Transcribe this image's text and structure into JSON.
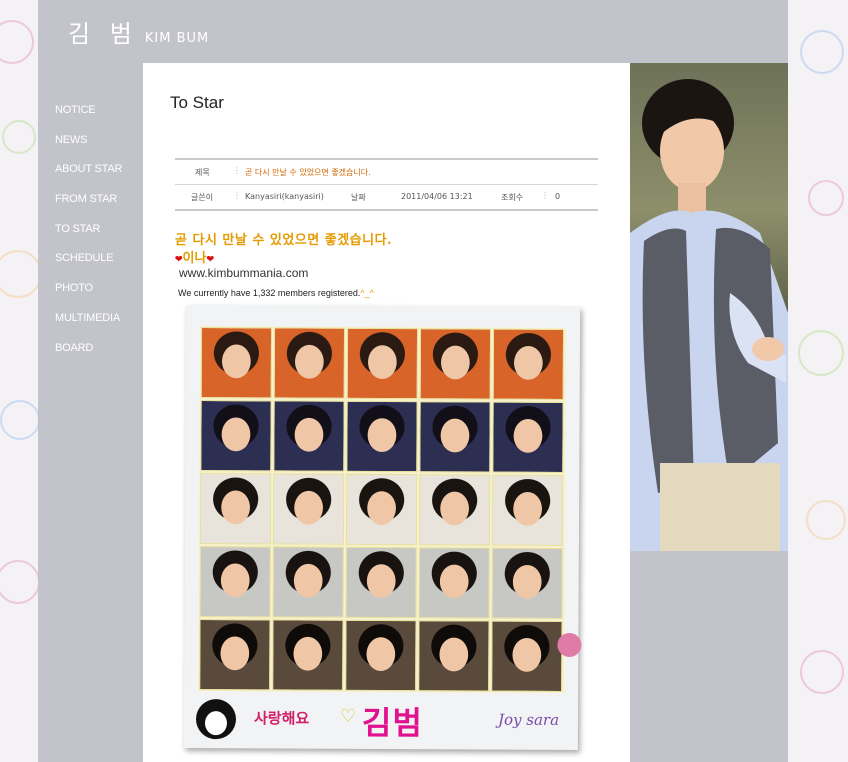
{
  "site": {
    "logo_korean": "김 범",
    "logo_english": "KIM BUM"
  },
  "nav": {
    "items": [
      {
        "label": "NOTICE"
      },
      {
        "label": "NEWS"
      },
      {
        "label": "ABOUT STAR"
      },
      {
        "label": "FROM STAR"
      },
      {
        "label": "TO STAR",
        "active": true
      },
      {
        "label": "SCHEDULE"
      },
      {
        "label": "PHOTO"
      },
      {
        "label": "MULTIMEDIA"
      },
      {
        "label": "BOARD"
      }
    ]
  },
  "page": {
    "title": "To Star"
  },
  "meta": {
    "subject_label": "제목",
    "subject_value": "곧 다시 만날 수 있었으면 좋겠습니다.",
    "author_label": "글쓴이",
    "author_value": "Kanyasiri(kanyasiri)",
    "date_label": "날짜",
    "date_value": "2011/04/06 13:21",
    "views_label": "조회수",
    "views_value": "0"
  },
  "post": {
    "title": "곧 다시 만날 수 있었으면 좋겠습니다.",
    "subtitle": "이나",
    "url": "www.kimbummania.com",
    "members_text": "We currently have 1,332 members registered.",
    "members_smiley": "^_^",
    "image": {
      "love_text": "사랑해요",
      "name": "김범",
      "signature": "Joy sara"
    }
  },
  "colors": {
    "frame_gray": "#c3c4cb",
    "accent_orange": "#e59a00",
    "heart_red": "#d81010",
    "name_pink": "#e0128f"
  },
  "icons": [
    "heart-icon",
    "flower-icon",
    "fan-face-icon"
  ]
}
